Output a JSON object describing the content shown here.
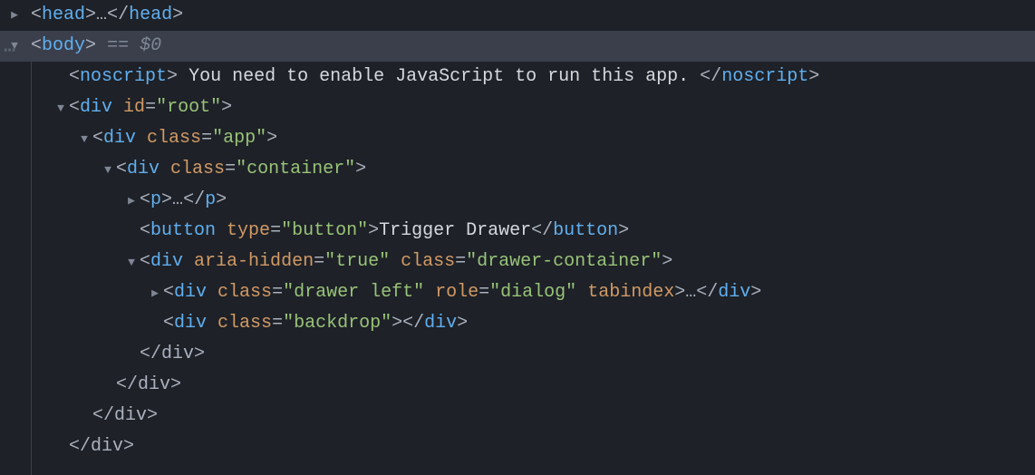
{
  "lines": {
    "head": {
      "tag": "head",
      "ellipsis": "…"
    },
    "body": {
      "tag": "body",
      "suffix": "== $0"
    },
    "noscript": {
      "tag": "noscript",
      "text": "You need to enable JavaScript to run this app."
    },
    "divRoot": {
      "tag": "div",
      "attrName": "id",
      "attrVal": "\"root\""
    },
    "divApp": {
      "tag": "div",
      "attrName": "class",
      "attrVal": "\"app\""
    },
    "divContainer": {
      "tag": "div",
      "attrName": "class",
      "attrVal": "\"container\""
    },
    "p": {
      "tag": "p",
      "ellipsis": "…"
    },
    "button": {
      "tag": "button",
      "attrName": "type",
      "attrVal": "\"button\"",
      "text": "Trigger Drawer"
    },
    "divDrawerContainer": {
      "tag": "div",
      "attr1Name": "aria-hidden",
      "attr1Val": "\"true\"",
      "attr2Name": "class",
      "attr2Val": "\"drawer-container\""
    },
    "divDrawerLeft": {
      "tag": "div",
      "attr1Name": "class",
      "attr1Val": "\"drawer left\"",
      "attr2Name": "role",
      "attr2Val": "\"dialog\"",
      "attr3Name": "tabindex",
      "ellipsis": "…"
    },
    "divBackdrop": {
      "tag": "div",
      "attrName": "class",
      "attrVal": "\"backdrop\""
    },
    "closeDiv": {
      "text": "</div>"
    }
  }
}
